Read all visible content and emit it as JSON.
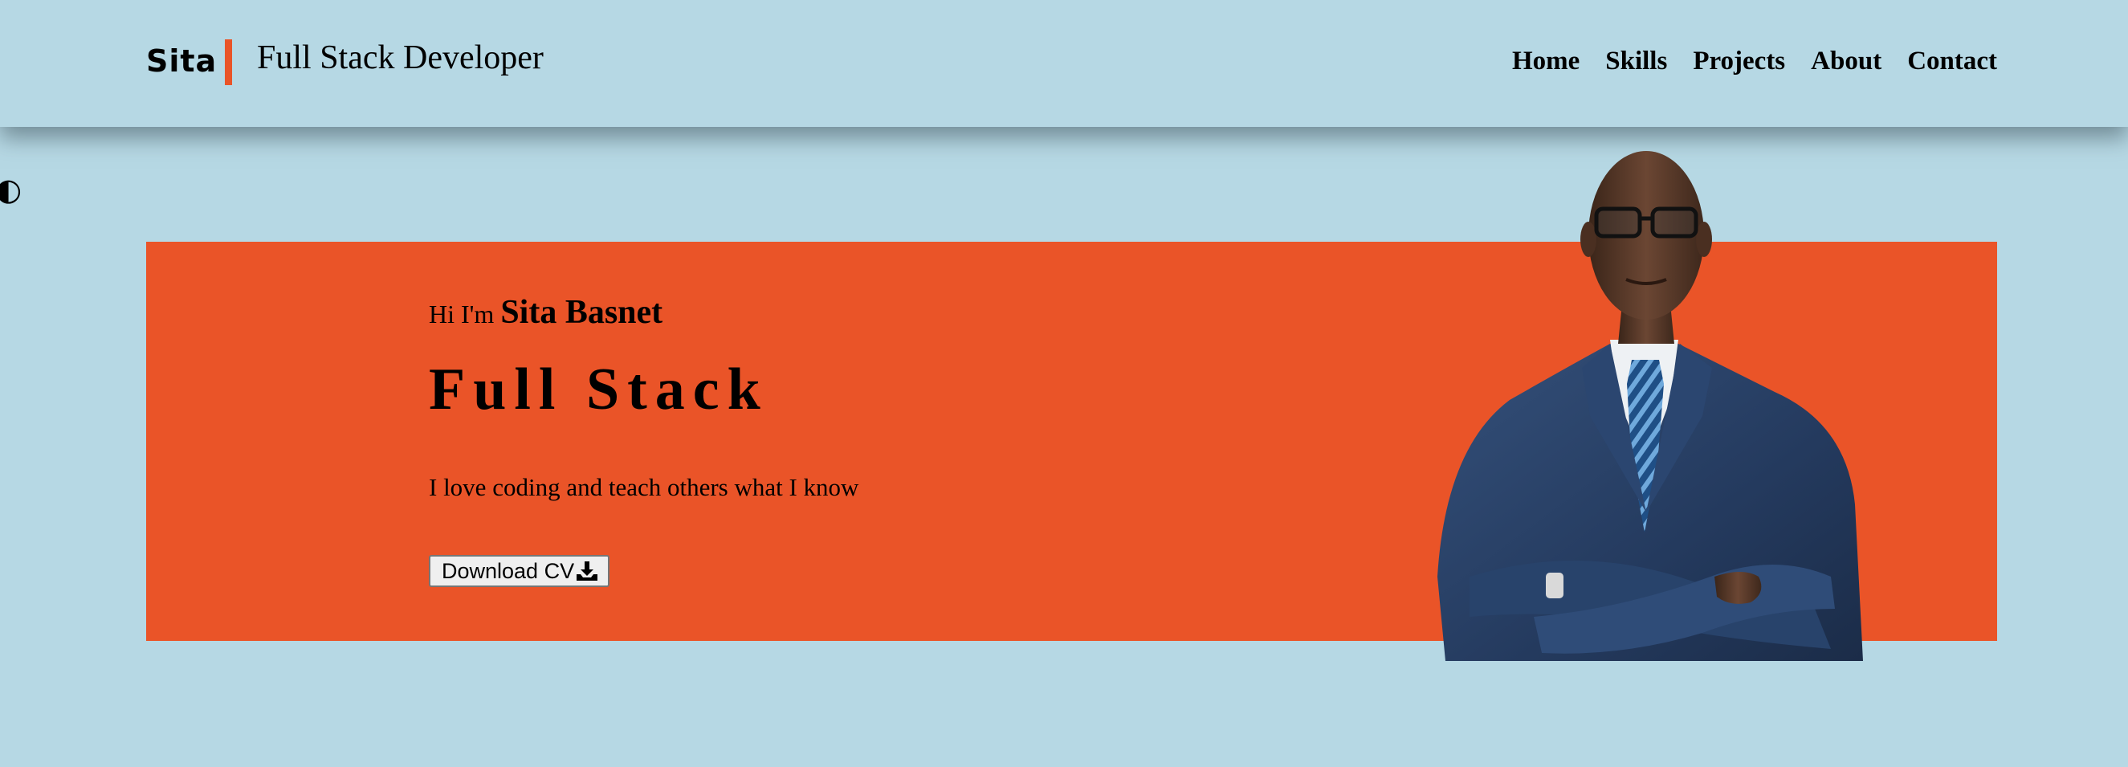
{
  "header": {
    "logo": "Sita",
    "role": "Full Stack Developer",
    "nav": [
      "Home",
      "Skills",
      "Projects",
      "About",
      "Contact"
    ]
  },
  "theme_toggle": {
    "icon": "half-circle-icon"
  },
  "hero": {
    "greeting": "Hi I'm",
    "name": "Sita Basnet",
    "title": "Full Stack",
    "tagline": "I love coding and teach others what I know",
    "cv_button": "Download CV",
    "cv_icon": "download-icon",
    "portrait_alt": "businessman-portrait"
  },
  "colors": {
    "background": "#b6d8e4",
    "accent": "#ea5428"
  }
}
